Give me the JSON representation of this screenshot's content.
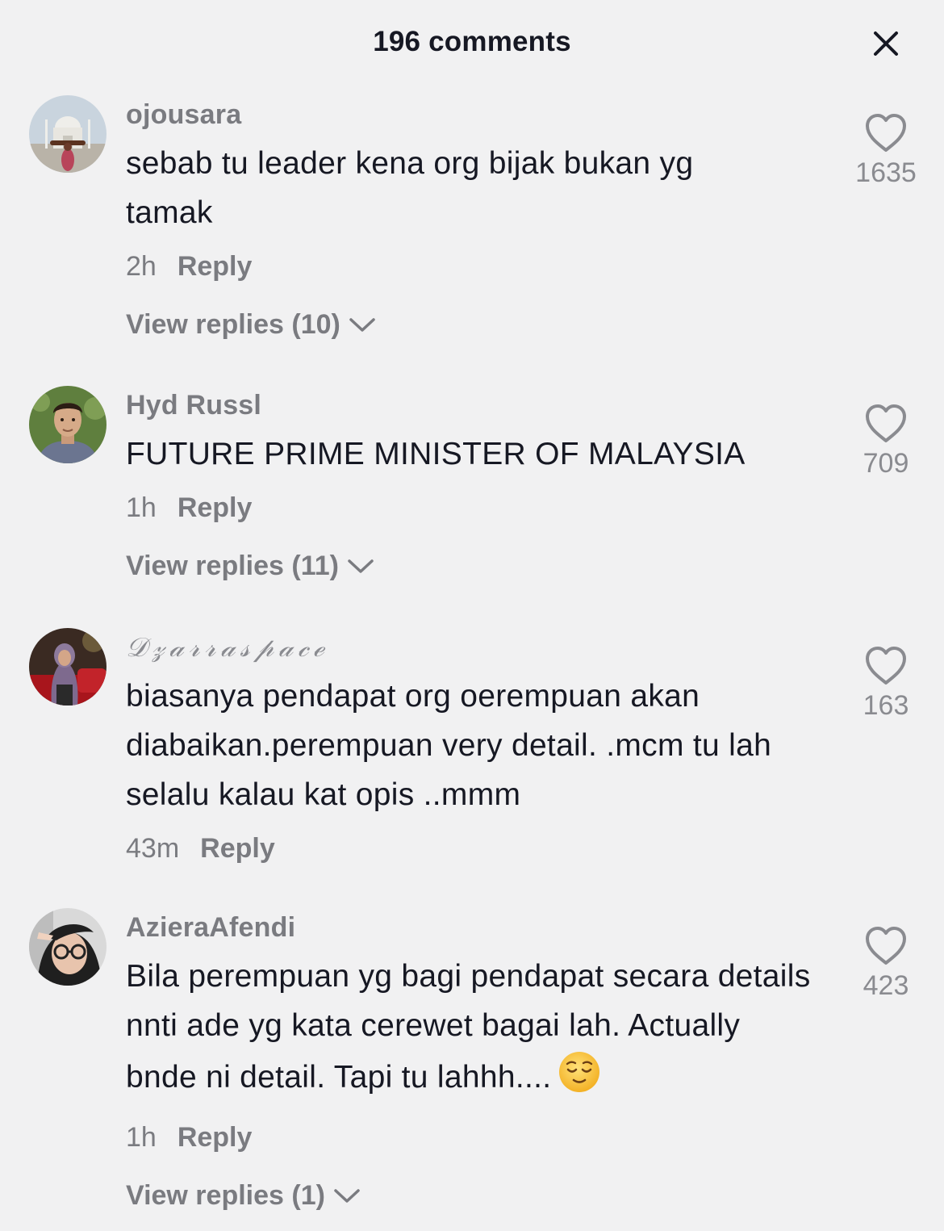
{
  "header": {
    "title": "196 comments",
    "close_icon": "close-icon"
  },
  "comments": [
    {
      "username": "ojousara",
      "text": "sebab tu leader kena org bijak bukan yg tamak",
      "time": "2h",
      "reply_label": "Reply",
      "likes": "1635",
      "view_replies": "View replies (10)",
      "avatar": "avatar-taj-mahal"
    },
    {
      "username": "Hyd Russl",
      "text": "FUTURE PRIME MINISTER OF MALAYSIA",
      "time": "1h",
      "reply_label": "Reply",
      "likes": "709",
      "view_replies": "View replies (11)",
      "avatar": "avatar-man-portrait"
    },
    {
      "username": "𝒟𝓏𝒶𝓇𝓇𝒶𝓈𝓅𝒶𝒸ℯ",
      "text": "biasanya pendapat org oerempuan akan diabaikan.perempuan very detail. .mcm tu lah selalu kalau kat opis ..mmm",
      "time": "43m",
      "reply_label": "Reply",
      "likes": "163",
      "avatar": "avatar-hijab-woman"
    },
    {
      "username": "AzieraAfendi",
      "text": "Bila perempuan yg bagi pendapat secara details nnti ade yg kata cerewet bagai lah. Actually bnde ni detail. Tapi tu lahhh....",
      "emoji": "😌",
      "time": "1h",
      "reply_label": "Reply",
      "likes": "423",
      "view_replies": "View replies (1)",
      "avatar": "avatar-glasses-woman"
    }
  ],
  "colors": {
    "background": "#f1f1f2",
    "text_primary": "#161823",
    "text_secondary": "#7a7b80"
  }
}
